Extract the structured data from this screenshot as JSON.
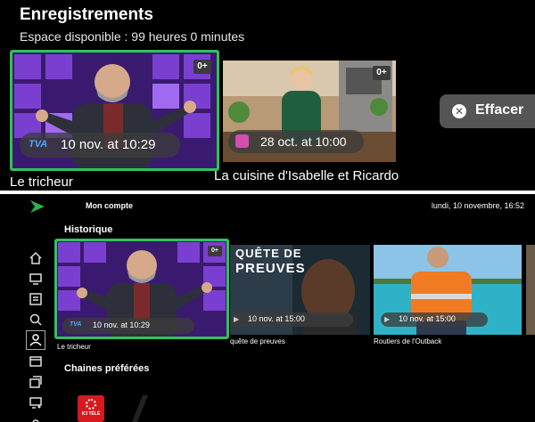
{
  "top": {
    "title": "Enregistrements",
    "subtitle": "Espace disponible : 99 heures 0 minutes",
    "cards": [
      {
        "rating": "0+",
        "date": "10 nov. at 10:29",
        "channel_logo_text": "TVA",
        "title": "Le tricheur"
      },
      {
        "rating": "0+",
        "date": "28 oct. at 10:00",
        "title": "La cuisine d'Isabelle et Ricardo"
      }
    ],
    "clear_button": "Effacer"
  },
  "bottom": {
    "account": "Mon compte",
    "datetime": "lundi, 10 novembre, 16:52",
    "history_title": "Historique",
    "history": [
      {
        "rating": "0+",
        "date": "10 nov. at 10:29",
        "title": "Le tricheur"
      },
      {
        "poster_line1": "QUÊTE DE",
        "poster_line2": "PREUVES",
        "date": "10 nov. at 15:00",
        "title": "quête de preuves"
      },
      {
        "date": "10 nov. at 15:00",
        "title": "Routiers de l'Outback"
      }
    ],
    "favorites_title": "Chaines préférées",
    "favorites": [
      {
        "logo_text": "ICI TÉLÉ"
      }
    ]
  },
  "colors": {
    "focus": "#2ec45a",
    "accent": "#2bb24c"
  },
  "icons": [
    "home-icon",
    "tv-icon",
    "guide-icon",
    "search-icon",
    "account-icon",
    "recordings-icon",
    "library-icon",
    "devices-icon",
    "settings-icon"
  ]
}
